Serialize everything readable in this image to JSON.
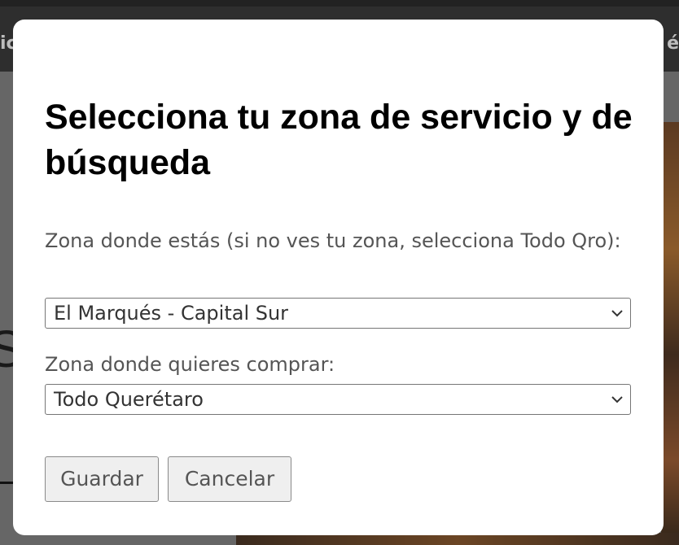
{
  "background": {
    "nav_left_text": "ic",
    "nav_right_text": "é",
    "big_letter": "S"
  },
  "modal": {
    "title": "Selecciona tu zona de servicio y de búsqueda",
    "current_zone": {
      "label": "Zona donde estás (si no ves tu zona, selecciona Todo Qro):",
      "selected": "El Marqués - Capital Sur"
    },
    "shopping_zone": {
      "label": "Zona donde quieres comprar:",
      "selected": "Todo Querétaro"
    },
    "buttons": {
      "save": "Guardar",
      "cancel": "Cancelar"
    }
  },
  "icons": {
    "dropdown": "chevron-down-icon"
  },
  "colors": {
    "modal_bg": "#ffffff",
    "overlay": "#4a4a4a",
    "label_text": "#555555",
    "title_text": "#000000",
    "button_bg": "#efefef"
  }
}
